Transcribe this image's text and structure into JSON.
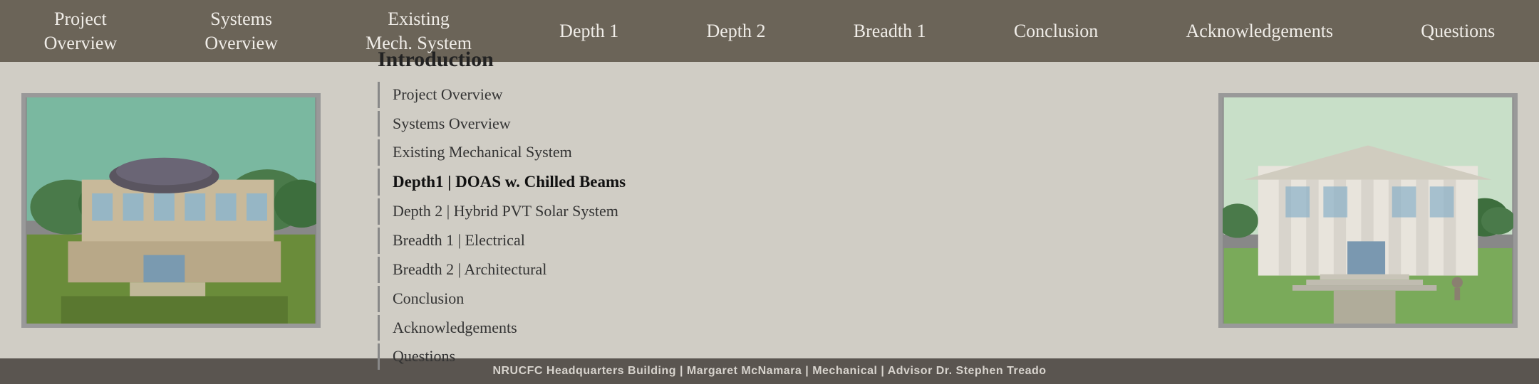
{
  "nav": {
    "items": [
      {
        "label": "Project\nOverview",
        "id": "project-overview"
      },
      {
        "label": "Systems\nOverview",
        "id": "systems-overview"
      },
      {
        "label": "Existing\nMech. System",
        "id": "existing-mech"
      },
      {
        "label": "Depth 1",
        "id": "depth1"
      },
      {
        "label": "Depth 2",
        "id": "depth2"
      },
      {
        "label": "Breadth 1",
        "id": "breadth1"
      },
      {
        "label": "Conclusion",
        "id": "conclusion"
      },
      {
        "label": "Acknowledgements",
        "id": "acknowledgements"
      },
      {
        "label": "Questions",
        "id": "questions"
      }
    ]
  },
  "main": {
    "intro_title": "Introduction",
    "toc_items": [
      {
        "text": "Project Overview",
        "bold": false
      },
      {
        "text": "Systems Overview",
        "bold": false
      },
      {
        "text": "Existing Mechanical System",
        "bold": false
      },
      {
        "text": "Depth1 | DOAS w. Chilled Beams",
        "bold": true
      },
      {
        "text": "Depth 2 | Hybrid PVT Solar System",
        "bold": false
      },
      {
        "text": "Breadth 1 | Electrical",
        "bold": false
      },
      {
        "text": "Breadth 2 | Architectural",
        "bold": false
      },
      {
        "text": "Conclusion",
        "bold": false
      },
      {
        "text": "Acknowledgements",
        "bold": false
      },
      {
        "text": "Questions",
        "bold": false
      }
    ]
  },
  "footer": {
    "text": "NRUCFC Headquarters Building | Margaret McNamara | Mechanical | Advisor Dr. Stephen Treado"
  }
}
